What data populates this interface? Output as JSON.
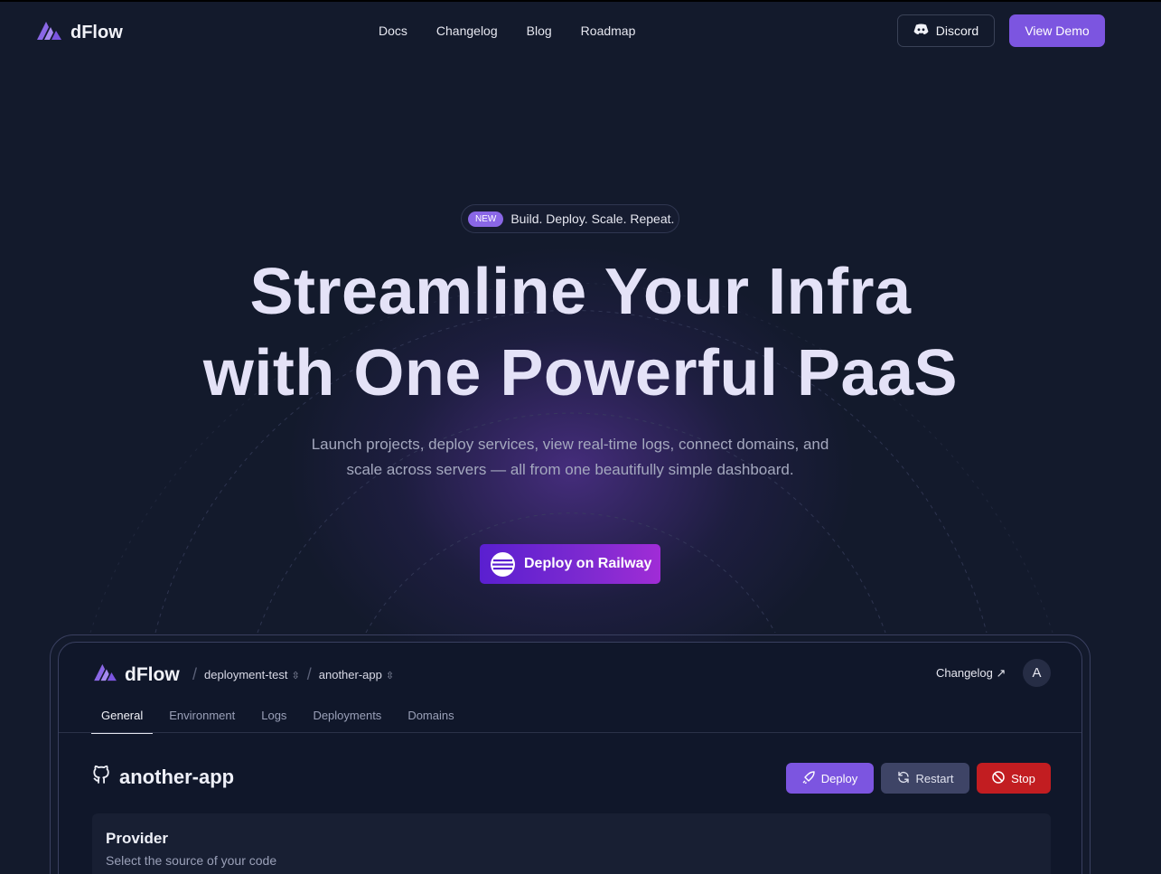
{
  "nav": {
    "brand": "dFlow",
    "links": [
      "Docs",
      "Changelog",
      "Blog",
      "Roadmap"
    ],
    "discord_label": "Discord",
    "demo_label": "View Demo"
  },
  "hero": {
    "badge_pill": "NEW",
    "badge_text": "Build. Deploy. Scale. Repeat.",
    "headline_line1": "Streamline Your Infra",
    "headline_line2": "with One Powerful PaaS",
    "subtitle": "Launch projects, deploy services, view real-time logs, connect domains, and scale across servers — all from one beautifully simple dashboard.",
    "cta_label": "Deploy on Railway"
  },
  "app": {
    "brand": "dFlow",
    "breadcrumb": [
      "deployment-test",
      "another-app"
    ],
    "changelog_label": "Changelog ↗",
    "avatar_initial": "A",
    "tabs": [
      "General",
      "Environment",
      "Logs",
      "Deployments",
      "Domains"
    ],
    "active_tab": "General",
    "title": "another-app",
    "actions": {
      "deploy": "Deploy",
      "restart": "Restart",
      "stop": "Stop"
    },
    "provider": {
      "title": "Provider",
      "subtitle": "Select the source of your code"
    }
  },
  "colors": {
    "background": "#131a2c",
    "accent": "#7c55e0",
    "danger": "#c21d21",
    "secondary_button": "#3e4466"
  }
}
